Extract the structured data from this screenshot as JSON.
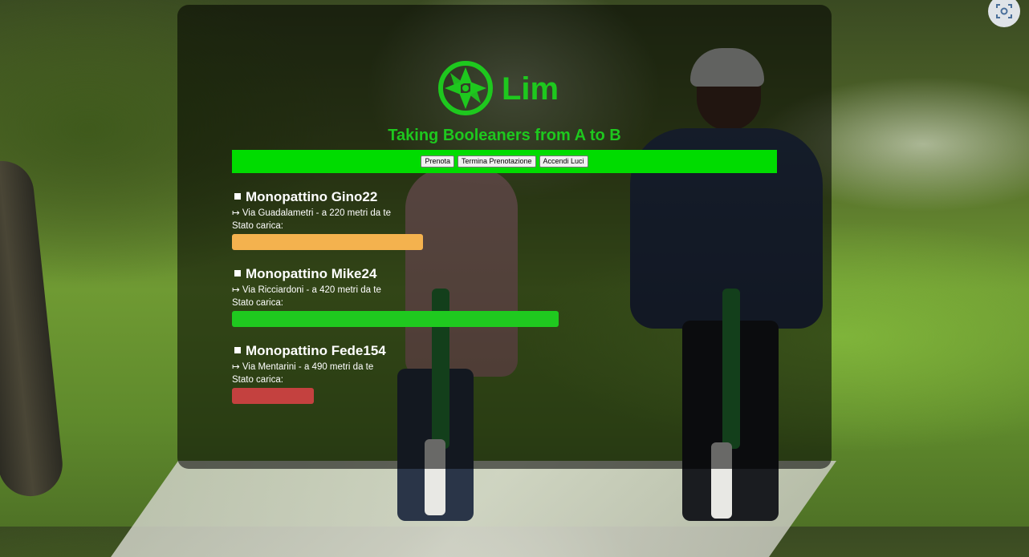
{
  "brand": {
    "name": "Lim",
    "tagline": "Taking Booleaners from A to B",
    "color": "#1ec81e"
  },
  "nav": {
    "buttons": [
      "Prenota",
      "Termina Prenotazione",
      "Accendi Luci"
    ],
    "bar_color": "#00dc00"
  },
  "scooters": [
    {
      "name": "Monopattino Gino22",
      "location": "↦ Via Guadalametri - a 220 metri da te",
      "charge_label": "Stato carica:",
      "charge_fraction": 0.35,
      "charge_color": "#f4b24e"
    },
    {
      "name": "Monopattino Mike24",
      "location": "↦ Via Ricciardoni - a 420 metri da te",
      "charge_label": "Stato carica:",
      "charge_fraction": 0.6,
      "charge_color": "#1fc91f"
    },
    {
      "name": "Monopattino Fede154",
      "location": "↦ Via Mentarini - a 490 metri da te",
      "charge_label": "Stato carica:",
      "charge_fraction": 0.15,
      "charge_color": "#c4413f"
    }
  ],
  "icons": {
    "screenshot": "screen-capture-icon",
    "logo": "lime-wheel-logo-icon"
  }
}
